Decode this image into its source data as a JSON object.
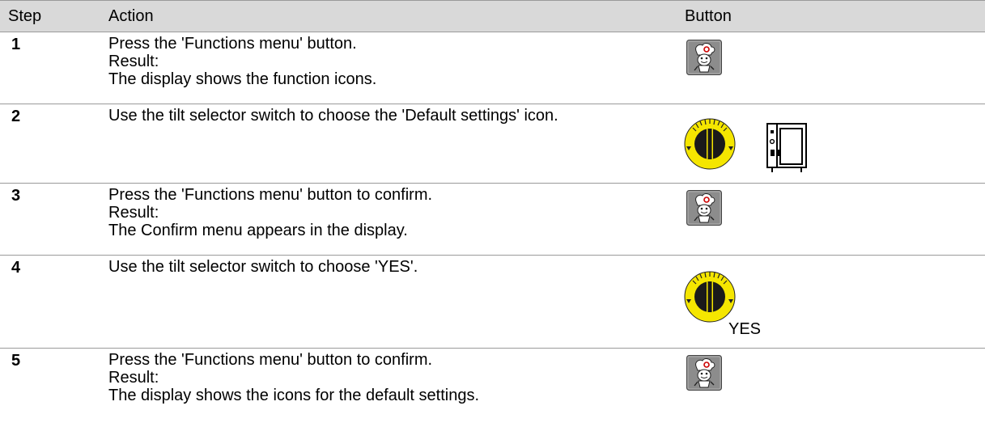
{
  "table": {
    "headers": {
      "step": "Step",
      "action": "Action",
      "button": "Button"
    },
    "rows": [
      {
        "step": "1",
        "action": "Press the 'Functions menu' button.",
        "result_label": "Result:",
        "result": "The display shows the function icons.",
        "icons": [
          "chef-functions-menu-icon"
        ]
      },
      {
        "step": "2",
        "action": "Use the tilt selector switch to choose the 'Default settings' icon.",
        "icons": [
          "tilt-selector-knob-icon",
          "oven-default-settings-icon"
        ]
      },
      {
        "step": "3",
        "action": "Press the 'Functions menu' button to confirm.",
        "result_label": "Result:",
        "result": "The Confirm menu appears in the display.",
        "icons": [
          "chef-functions-menu-icon"
        ]
      },
      {
        "step": "4",
        "action": "Use the tilt selector switch to choose 'YES'.",
        "icon_label": "YES",
        "icons": [
          "tilt-selector-knob-icon"
        ]
      },
      {
        "step": "5",
        "action": "Press the 'Functions menu' button to confirm.",
        "result_label": "Result:",
        "result": "The display shows the icons for the default settings.",
        "icons": [
          "chef-functions-menu-icon"
        ]
      }
    ]
  },
  "colors": {
    "header_bg": "#d9d9d9",
    "rule": "#9a9a9a",
    "knob_yellow": "#f5e600",
    "chef_button_bg": "#8c8c8c",
    "chef_accent": "#cc0000"
  }
}
